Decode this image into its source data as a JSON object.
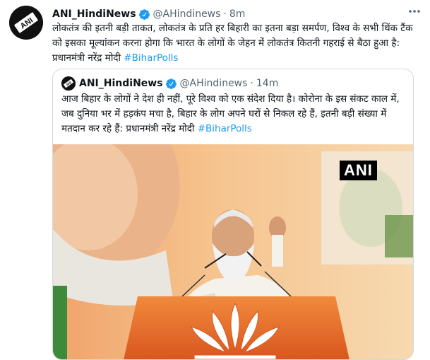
{
  "tweet": {
    "author_name": "ANI_HindiNews",
    "handle": "@AHindinews",
    "separator": "·",
    "time": "8m",
    "text": "लोकतंत्र की इतनी बड़ी ताकत, लोकतंत्र के प्रति हर बिहारी का इतना बड़ा समर्पण, विश्व के सभी थिंक टैंक को इसका मूल्यांकन करना होगा कि भारत के लोगों के जेहन में लोकतंत्र कितनी गहराई से बैठा हुआ है: प्रधानमंत्री नरेंद्र मोदी",
    "hashtag": "#BiharPolls",
    "avatar_label": "ANI",
    "icons": {
      "verified": "verified-badge-icon",
      "more": "more-options-icon"
    }
  },
  "quoted": {
    "author_name": "ANI_HindiNews",
    "handle": "@AHindinews",
    "separator": "·",
    "time": "14m",
    "text": "आज बिहार के लोगों ने देश ही नहीं, पूरे विश्व को एक संदेश दिया है। कोरोना के इस संकट काल में, जब दुनिया भर में हड़कंप मचा है, बिहार के लोग अपने घरों से निकल रहे हैं, इतनी बड़ी संख्या में मतदान कर रहे हैं: प्रधानमंत्री नरेंद्र मोदी",
    "hashtag": "#BiharPolls",
    "media_watermark": "ANI"
  },
  "colors": {
    "accent": "#1d9bf0",
    "text": "#0f1419",
    "secondary": "#536471",
    "border": "#cfd9de",
    "stage_orange": "#e8722c"
  }
}
